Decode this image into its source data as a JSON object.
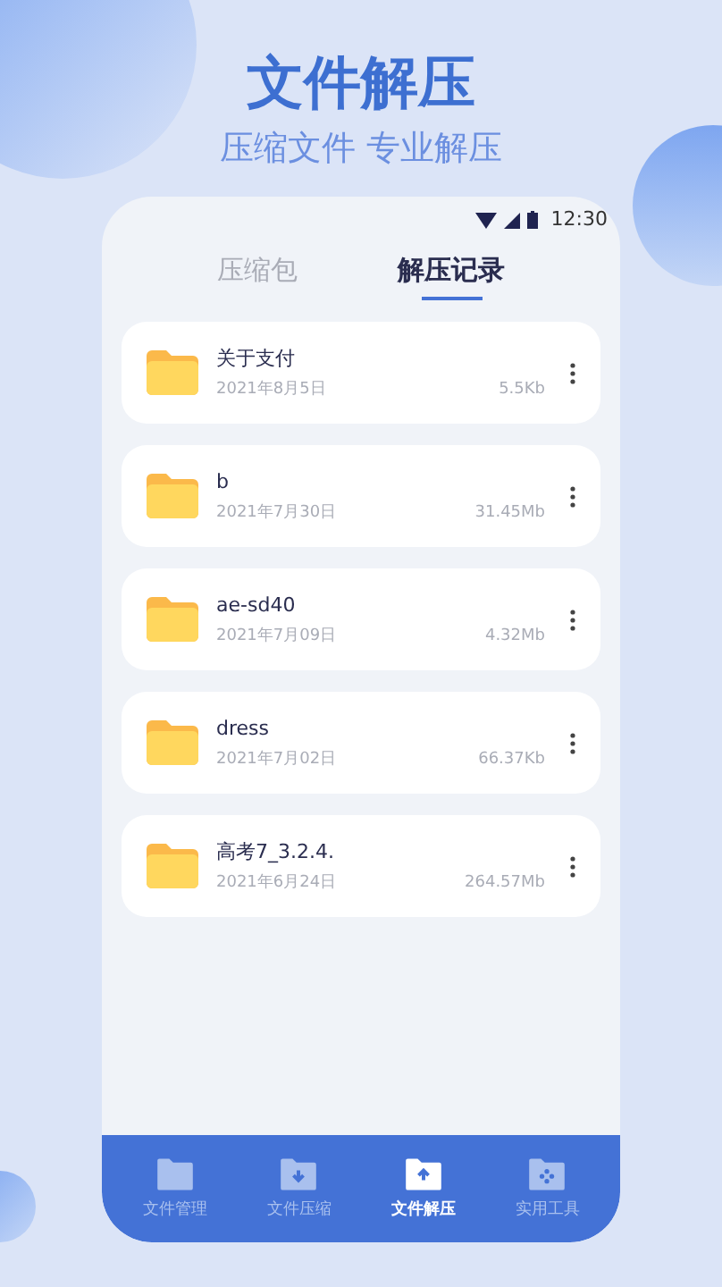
{
  "headline": "文件解压",
  "subheadline": "压缩文件 专业解压",
  "status_bar": {
    "time": "12:30"
  },
  "tabs": [
    {
      "label": "压缩包",
      "selected": false
    },
    {
      "label": "解压记录",
      "selected": true
    }
  ],
  "files": [
    {
      "name": "关于支付",
      "date": "2021年8月5日",
      "size": "5.5Kb"
    },
    {
      "name": "b",
      "date": "2021年7月30日",
      "size": "31.45Mb"
    },
    {
      "name": "ae-sd40",
      "date": "2021年7月09日",
      "size": "4.32Mb"
    },
    {
      "name": "dress",
      "date": "2021年7月02日",
      "size": "66.37Kb"
    },
    {
      "name": "高考7_3.2.4.",
      "date": "2021年6月24日",
      "size": "264.57Mb"
    }
  ],
  "bottom_nav": [
    {
      "label": "文件管理",
      "kind": "folder",
      "selected": false
    },
    {
      "label": "文件压缩",
      "kind": "down",
      "selected": false
    },
    {
      "label": "文件解压",
      "kind": "up",
      "selected": true
    },
    {
      "label": "实用工具",
      "kind": "tools",
      "selected": false
    }
  ]
}
